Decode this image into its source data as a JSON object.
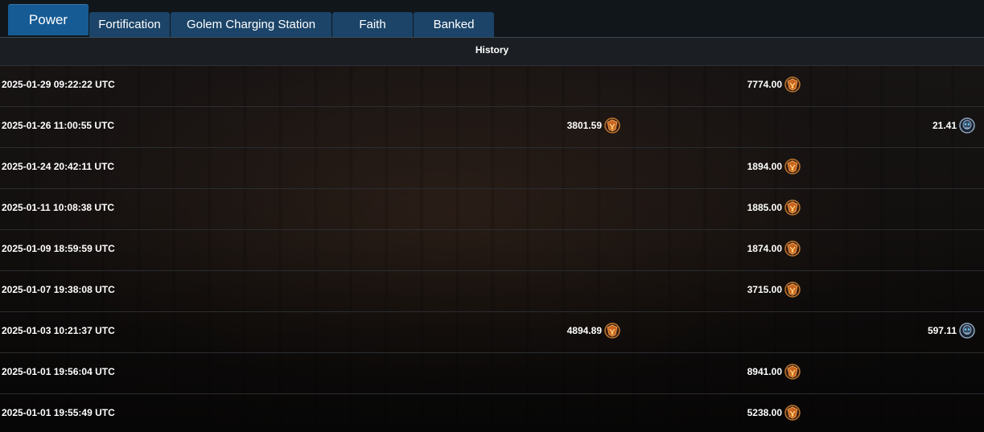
{
  "tabs": [
    {
      "label": "Power",
      "active": true
    },
    {
      "label": "Fortification",
      "active": false
    },
    {
      "label": "Golem Charging Station",
      "active": false
    },
    {
      "label": "Faith",
      "active": false
    },
    {
      "label": "Banked",
      "active": false
    }
  ],
  "history": {
    "title": "History",
    "rows": [
      {
        "date": "2025-01-29 09:22:22 UTC",
        "col1": "",
        "col2": "7774.00",
        "col3": ""
      },
      {
        "date": "2025-01-26 11:00:55 UTC",
        "col1": "3801.59",
        "col2": "",
        "col3": "21.41"
      },
      {
        "date": "2025-01-24 20:42:11 UTC",
        "col1": "",
        "col2": "1894.00",
        "col3": ""
      },
      {
        "date": "2025-01-11 10:08:38 UTC",
        "col1": "",
        "col2": "1885.00",
        "col3": ""
      },
      {
        "date": "2025-01-09 18:59:59 UTC",
        "col1": "",
        "col2": "1874.00",
        "col3": ""
      },
      {
        "date": "2025-01-07 19:38:08 UTC",
        "col1": "",
        "col2": "3715.00",
        "col3": ""
      },
      {
        "date": "2025-01-03 10:21:37 UTC",
        "col1": "4894.89",
        "col2": "",
        "col3": "597.11"
      },
      {
        "date": "2025-01-01 19:56:04 UTC",
        "col1": "",
        "col2": "8941.00",
        "col3": ""
      },
      {
        "date": "2025-01-01 19:55:49 UTC",
        "col1": "",
        "col2": "5238.00",
        "col3": ""
      }
    ]
  },
  "icons": {
    "col1": "bronze-emblem-icon",
    "col2": "bronze-emblem-icon",
    "col3": "blue-skull-emblem-icon"
  },
  "colors": {
    "tab_active": "#165b94",
    "tab_inactive": "#1b4468",
    "header_bg": "#1b1f24"
  }
}
